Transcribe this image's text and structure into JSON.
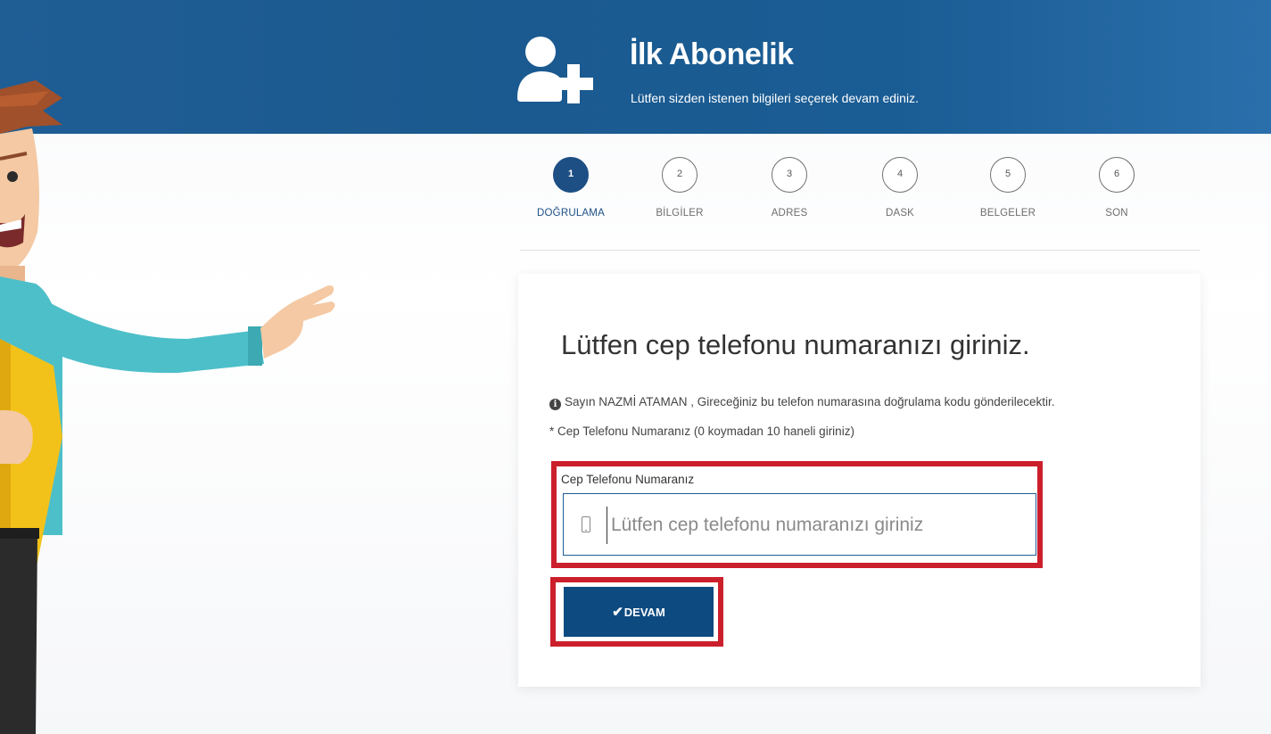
{
  "header": {
    "title": "İlk Abonelik",
    "subtitle": "Lütfen sizden istenen bilgileri seçerek devam ediniz.",
    "icon": "add-user-icon"
  },
  "stepper": {
    "steps": [
      {
        "number": "1",
        "label": "DOĞRULAMA",
        "active": true
      },
      {
        "number": "2",
        "label": "BİLGİLER",
        "active": false
      },
      {
        "number": "3",
        "label": "ADRES",
        "active": false
      },
      {
        "number": "4",
        "label": "DASK",
        "active": false
      },
      {
        "number": "5",
        "label": "BELGELER",
        "active": false
      },
      {
        "number": "6",
        "label": "SON",
        "active": false
      }
    ]
  },
  "card": {
    "title": "Lütfen cep telefonu numaranızı giriniz.",
    "info_text": "Sayın NAZMİ ATAMAN , Gireceğiniz bu telefon numarasına doğrulama kodu gönderilecektir.",
    "note_text": "* Cep Telefonu Numaranız (0 koymadan 10 haneli giriniz)",
    "phone_field": {
      "label": "Cep Telefonu Numaranız",
      "placeholder": "Lütfen cep telefonu numaranızı giriniz",
      "value": ""
    },
    "submit_label": "DEVAM"
  },
  "colors": {
    "header_blue": "#1f5d95",
    "active_step": "#1d4f84",
    "button_blue": "#0d4a80",
    "highlight_red": "#cc1f2c"
  }
}
